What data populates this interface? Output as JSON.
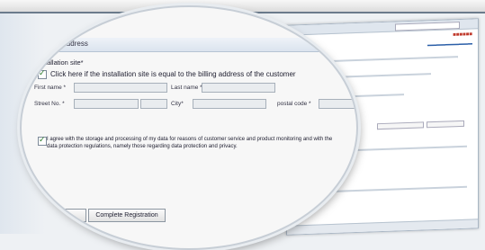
{
  "section": {
    "title": "Shipping address"
  },
  "installation": {
    "title": "Installation site*",
    "same_as_billing_label": "Click here if the installation site is equal to the billing address of the customer",
    "fields": {
      "first_name_label": "First name *",
      "last_name_label": "Last name *",
      "street_label": "Street No. *",
      "city_label": "City*",
      "postal_label": "postal code *"
    }
  },
  "consent": {
    "text": "I agree with the storage and processing of my data for reasons of customer service and product monitoring and with the data protection regulations, namely those regarding data protection and privacy."
  },
  "buttons": {
    "complete": "Complete Registration"
  },
  "colors": {
    "check": "#2a7a2a",
    "header_bg": "#dbe4ee",
    "brand_red": "#c0392b",
    "link_blue": "#2b5fa8"
  }
}
